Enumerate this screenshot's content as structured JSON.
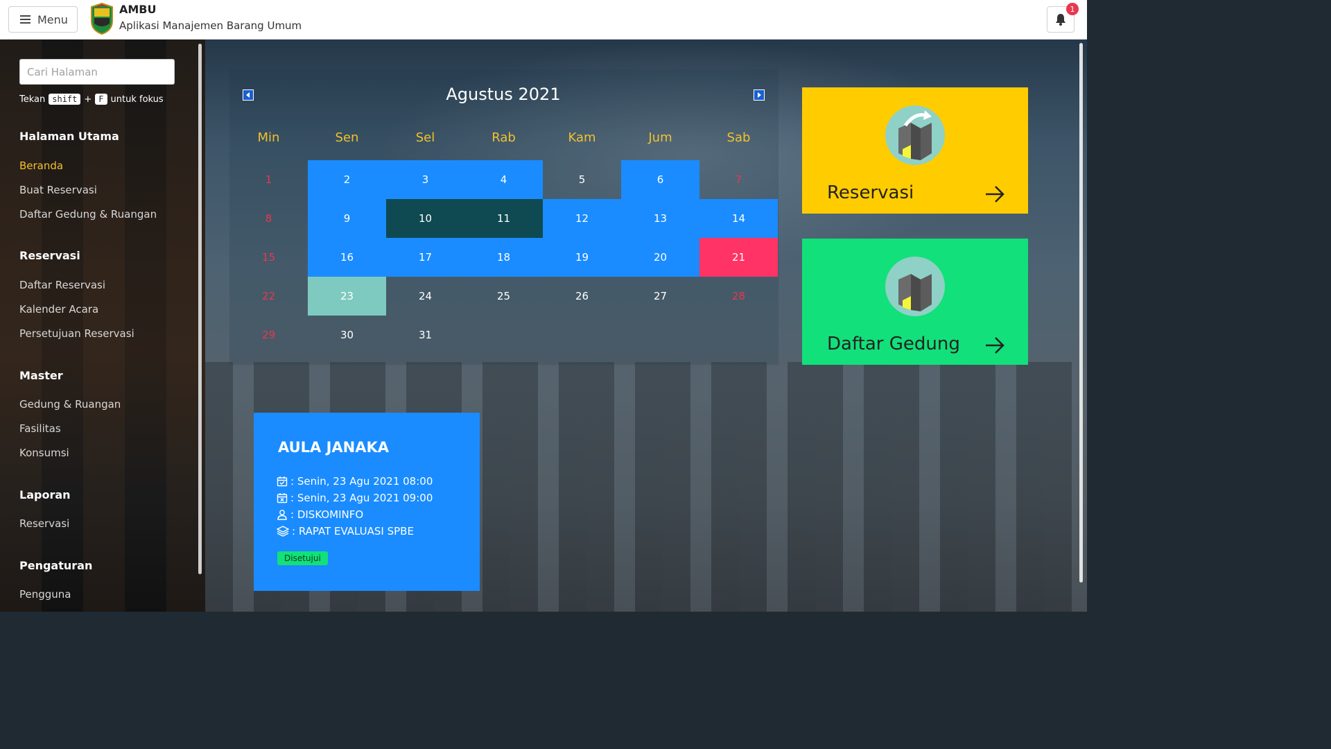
{
  "topbar": {
    "menu_label": "Menu",
    "app_name": "AMBU",
    "app_subtitle": "Aplikasi Manajemen Barang Umum",
    "notif_count": "1"
  },
  "sidebar": {
    "search_placeholder": "Cari Halaman",
    "hint_prefix": "Tekan",
    "hint_key1": "shift",
    "hint_plus": "+",
    "hint_key2": "F",
    "hint_suffix": "untuk fokus",
    "sections": [
      {
        "title": "Halaman Utama",
        "items": [
          "Beranda",
          "Buat Reservasi",
          "Daftar Gedung & Ruangan"
        ]
      },
      {
        "title": "Reservasi",
        "items": [
          "Daftar Reservasi",
          "Kalender Acara",
          "Persetujuan Reservasi"
        ]
      },
      {
        "title": "Master",
        "items": [
          "Gedung & Ruangan",
          "Fasilitas",
          "Konsumsi"
        ]
      },
      {
        "title": "Laporan",
        "items": [
          "Reservasi"
        ]
      },
      {
        "title": "Pengaturan",
        "items": [
          "Pengguna"
        ]
      }
    ],
    "active_item": "Beranda"
  },
  "calendar": {
    "title": "Agustus 2021",
    "days_of_week": [
      "Min",
      "Sen",
      "Sel",
      "Rab",
      "Kam",
      "Jum",
      "Sab"
    ],
    "weeks": [
      [
        "1",
        "2",
        "3",
        "4",
        "5",
        "6",
        "7"
      ],
      [
        "8",
        "9",
        "10",
        "11",
        "12",
        "13",
        "14"
      ],
      [
        "15",
        "16",
        "17",
        "18",
        "19",
        "20",
        "21"
      ],
      [
        "22",
        "23",
        "24",
        "25",
        "26",
        "27",
        "28"
      ],
      [
        "29",
        "30",
        "31",
        "",
        "",
        "",
        ""
      ]
    ],
    "highlight_colors": {
      "booked": "#1a8cff",
      "dark": "#0f4a52",
      "holiday": "#ff3366",
      "selected": "#7fcac0"
    }
  },
  "cards": {
    "reservasi_label": "Reservasi",
    "gedung_label": "Daftar Gedung",
    "reservasi_color": "#ffcc00",
    "gedung_color": "#12e07a"
  },
  "event": {
    "title": "AULA JANAKA",
    "start": ": Senin, 23 Agu 2021 08:00",
    "end": ": Senin, 23 Agu 2021 09:00",
    "organizer": ": DISKOMINFO",
    "activity": ": RAPAT EVALUASI SPBE",
    "status": "Disetujui"
  }
}
